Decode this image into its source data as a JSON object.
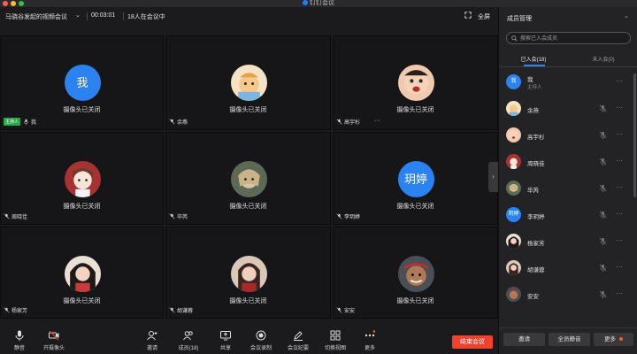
{
  "app": {
    "window_title": "钉钉会议"
  },
  "meeting": {
    "title": "马骁谷发起的视频会议",
    "timer": "00:03:01",
    "participant_count_text": "18人在会议中",
    "fullscreen_label": "全屏"
  },
  "tiles": [
    {
      "name": "我",
      "avatar_text": "我",
      "status": "摄像头已关闭",
      "host_badge": "主持人"
    },
    {
      "name": "余燕",
      "status": "摄像头已关闭"
    },
    {
      "name": "高宇杉",
      "status": "摄像头已关闭",
      "more": "···"
    },
    {
      "name": "周晓佳",
      "status": "摄像头已关闭"
    },
    {
      "name": "毕芮",
      "status": "摄像头已关闭"
    },
    {
      "name": "李玥婷",
      "avatar_text": "玥婷",
      "status": "摄像头已关闭"
    },
    {
      "name": "杨家芳",
      "status": "摄像头已关闭"
    },
    {
      "name": "胡谦蓉",
      "status": "摄像头已关闭"
    },
    {
      "name": "安安",
      "status": "摄像头已关闭"
    }
  ],
  "toolbar": {
    "mute_label": "静音",
    "camera_label": "开摄像头",
    "invite_label": "邀请",
    "members_label": "成员(18)",
    "share_label": "共享",
    "record_label": "会议录制",
    "minutes_label": "会议纪要",
    "switch_view_label": "切换视图",
    "more_label": "更多",
    "end_label": "结束会议"
  },
  "panel": {
    "title": "成员管理",
    "search_placeholder": "搜索已入会成员",
    "tab_joined": "已入会(18)",
    "tab_not_joined": "未入会(0)",
    "members": [
      {
        "name": "我",
        "avatar_text": "我",
        "role": "主持人"
      },
      {
        "name": "余燕"
      },
      {
        "name": "高宇杉"
      },
      {
        "name": "周晓佳"
      },
      {
        "name": "毕芮"
      },
      {
        "name": "李玥婷",
        "avatar_text": "玥婷"
      },
      {
        "name": "杨家芳"
      },
      {
        "name": "胡谦蓉"
      },
      {
        "name": "安安"
      }
    ],
    "invite_button": "邀请",
    "mute_all_button": "全员静音",
    "more_button": "更多"
  },
  "colors": {
    "accent_blue": "#2a83f0",
    "end_red": "#f2412c",
    "host_green": "#29a746"
  }
}
